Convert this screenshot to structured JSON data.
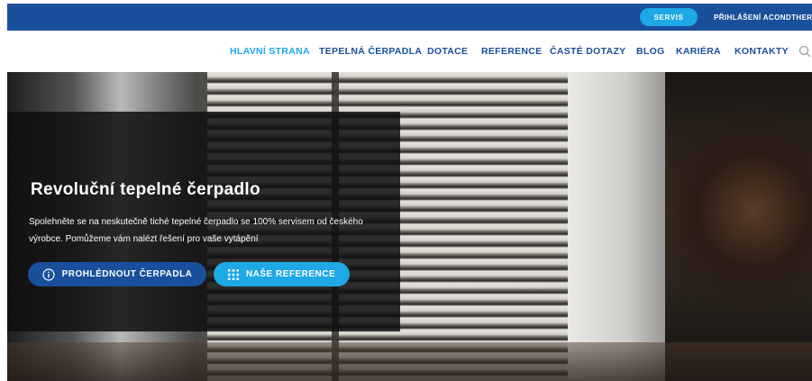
{
  "topbar": {
    "servis_label": "SERVIS",
    "login_label": "PŘIHLÁŠENÍ ACONDTHERM"
  },
  "nav": {
    "items": [
      {
        "label": "HLAVNÍ STRANA",
        "active": true
      },
      {
        "label": "TEPELNÁ ČERPADLA",
        "active": false
      },
      {
        "label": "DOTACE",
        "active": false
      },
      {
        "label": "REFERENCE",
        "active": false
      },
      {
        "label": "ČASTÉ DOTAZY",
        "active": false
      },
      {
        "label": "BLOG",
        "active": false
      },
      {
        "label": "KARIÉRA",
        "active": false
      },
      {
        "label": "KONTAKTY",
        "active": false
      }
    ],
    "search_icon": "search-icon"
  },
  "hero": {
    "title": "Revoluční tepelné čerpadlo",
    "text": "Spolehněte se na neskutečně tiché tepelné čerpadlo se 100% servisem od českého výrobce. Pomůžeme vám nalézt řešení pro vaše vytápění",
    "primary_button": {
      "label": "PROHLÉDNOUT ČERPADLA",
      "icon": "info-icon"
    },
    "secondary_button": {
      "label": "NAŠE REFERENCE",
      "icon": "grid-icon"
    }
  },
  "colors": {
    "brand_blue": "#1a4f9c",
    "accent_cyan": "#1ea8e6"
  }
}
